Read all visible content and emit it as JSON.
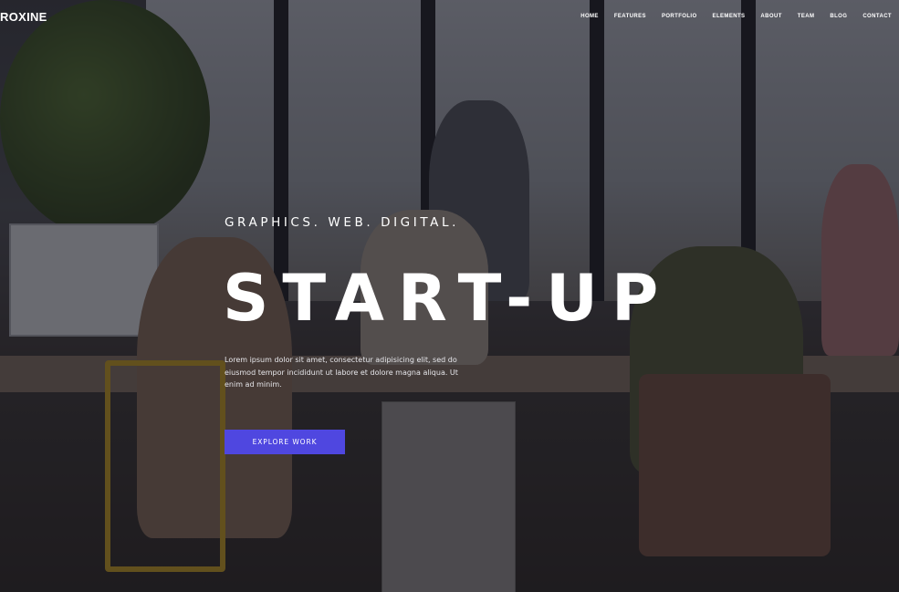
{
  "header": {
    "logo": "ROXINE",
    "nav": [
      "HOME",
      "FEATURES",
      "PORTFOLIO",
      "ELEMENTS",
      "ABOUT",
      "TEAM",
      "BLOG",
      "CONTACT"
    ]
  },
  "hero": {
    "tagline": "GRAPHICS. WEB. DIGITAL.",
    "headline": "START-UP",
    "lead": "Lorem ipsum dolor sit amet, consectetur adipisicing elit, sed do eiusmod tempor incididunt ut labore et dolore magna aliqua. Ut enim ad minim.",
    "cta_label": "EXPLORE WORK"
  },
  "colors": {
    "accent": "#4f47e0",
    "overlay": "#14141c",
    "text": "#ffffff"
  }
}
